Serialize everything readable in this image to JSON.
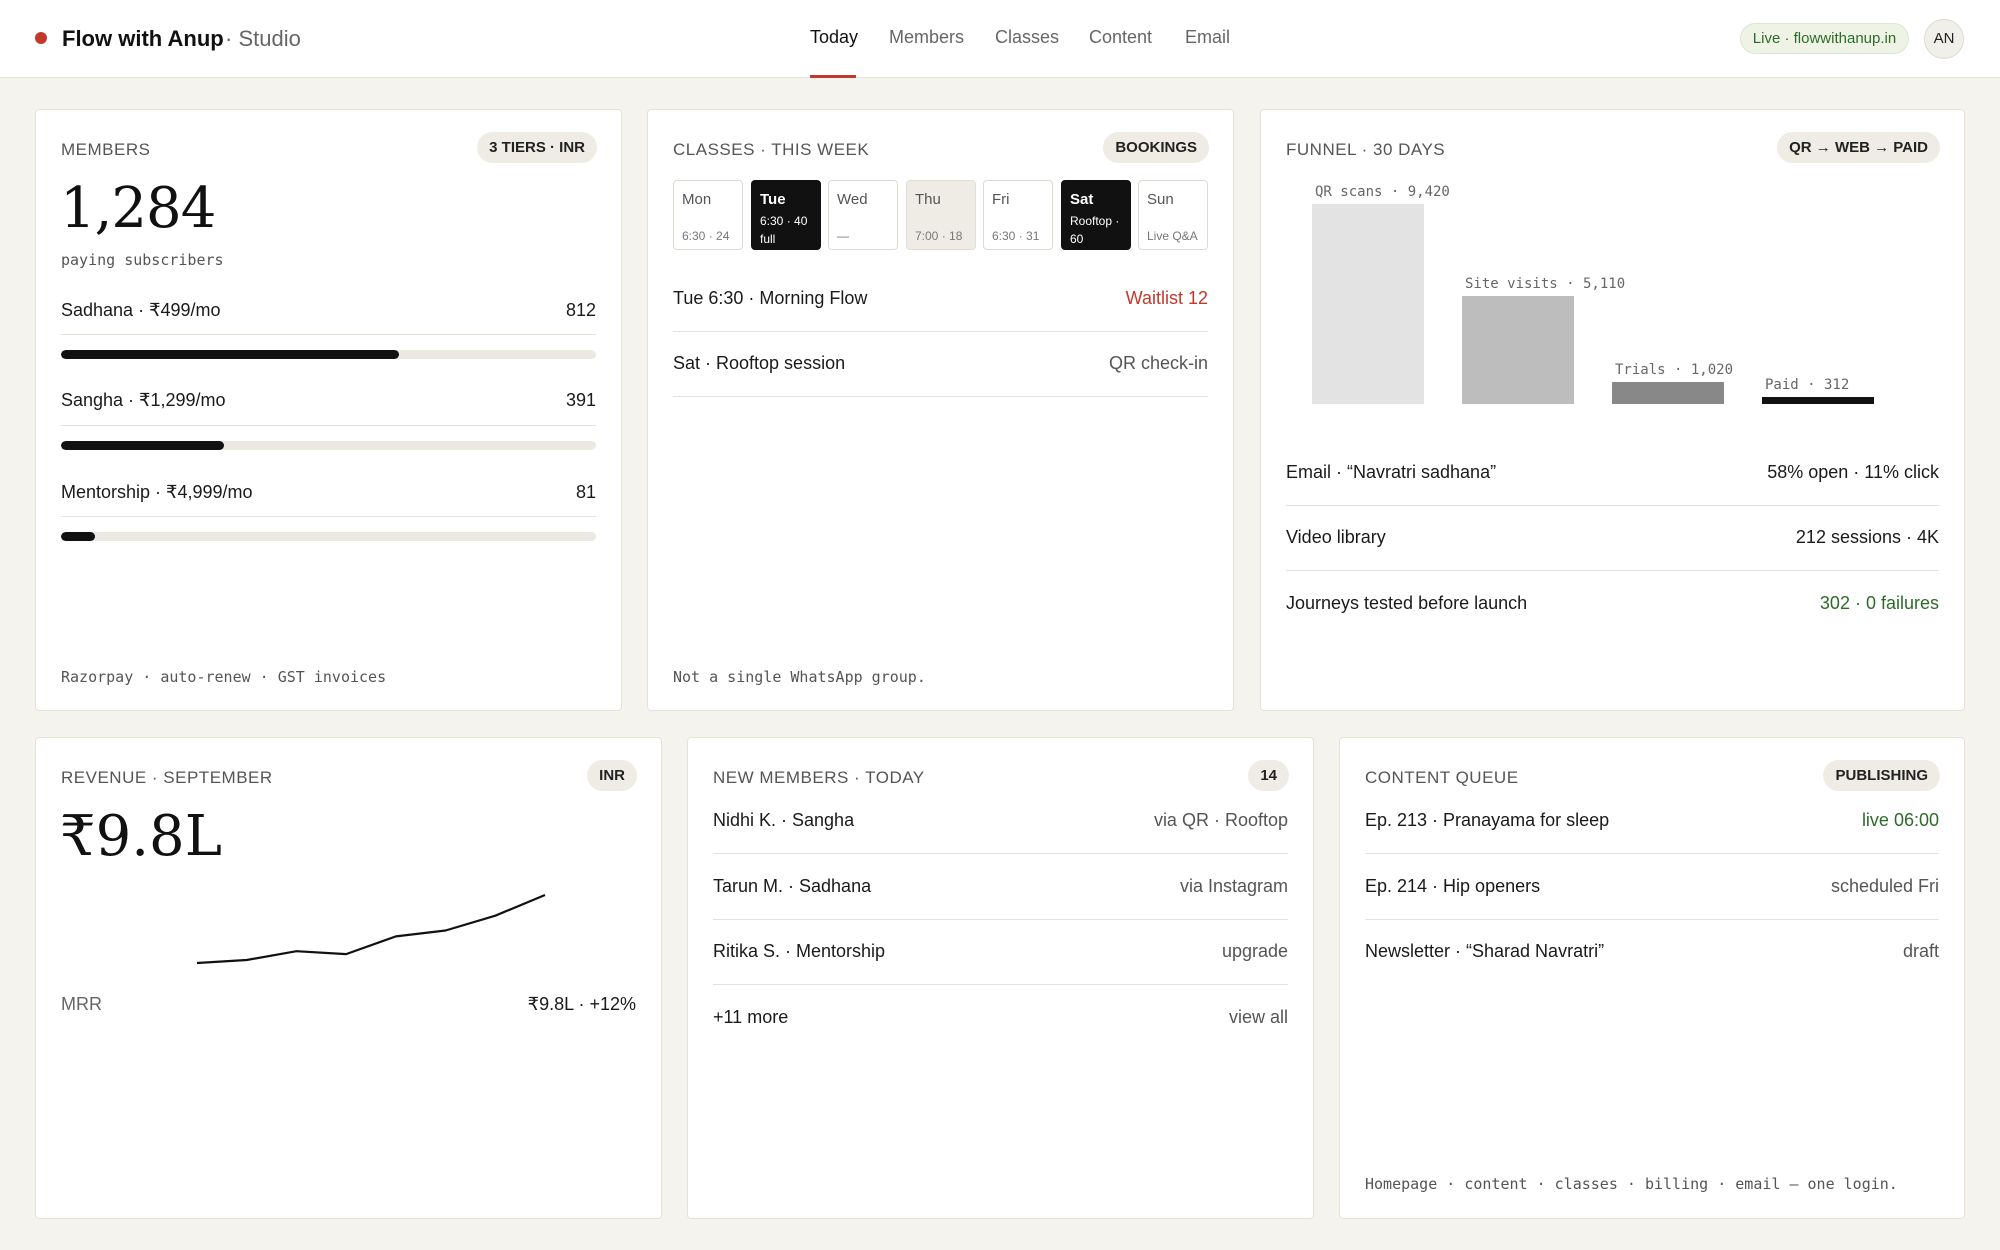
{
  "header": {
    "brand": "Flow with Anup",
    "brand_suffix": "· Studio",
    "tabs": [
      {
        "label": "Today",
        "active": true
      },
      {
        "label": "Members",
        "active": false
      },
      {
        "label": "Classes",
        "active": false
      },
      {
        "label": "Content",
        "active": false
      },
      {
        "label": "Email",
        "active": false
      }
    ],
    "live_status": "Live · flowwithanup.in",
    "avatar_initials": "AN"
  },
  "members": {
    "title": "MEMBERS",
    "badge": "3 TIERS · INR",
    "total": "1,284",
    "total_caption": "paying subscribers",
    "tiers": [
      {
        "label": "Sadhana · ₹499/mo",
        "value": "812",
        "count": 812
      },
      {
        "label": "Sangha · ₹1,299/mo",
        "value": "391",
        "count": 391
      },
      {
        "label": "Mentorship · ₹4,999/mo",
        "value": "81",
        "count": 81
      }
    ],
    "bar_max": 1284,
    "footnote": "Razorpay · auto-renew · GST invoices"
  },
  "classes": {
    "title": "CLASSES · THIS WEEK",
    "badge": "BOOKINGS",
    "days": [
      {
        "day": "Mon",
        "detail": "6:30 · 24",
        "style": "plain"
      },
      {
        "day": "Tue",
        "detail": "6:30 · 40 full",
        "style": "dark"
      },
      {
        "day": "Wed",
        "detail": "—",
        "style": "plain"
      },
      {
        "day": "Thu",
        "detail": "7:00 · 18",
        "style": "tinted"
      },
      {
        "day": "Fri",
        "detail": "6:30 · 31",
        "style": "plain"
      },
      {
        "day": "Sat",
        "detail": "Rooftop · 60",
        "style": "dark"
      },
      {
        "day": "Sun",
        "detail": "Live Q&A",
        "style": "plain"
      }
    ],
    "rows": [
      {
        "left": "Tue 6:30 · Morning Flow",
        "right": "Waitlist 12",
        "tone": "red"
      },
      {
        "left": "Sat · Rooftop session",
        "right": "QR check-in",
        "tone": "muted"
      }
    ],
    "footnote": "Not a single WhatsApp group."
  },
  "funnel": {
    "title": "FUNNEL · 30 DAYS",
    "badge": "QR → WEB → PAID",
    "chart_data": {
      "type": "bar",
      "categories": [
        "QR scans",
        "Site visits",
        "Trials",
        "Paid"
      ],
      "values": [
        9420,
        5110,
        1020,
        312
      ],
      "labels": [
        "QR scans · 9,420",
        "Site visits · 5,110",
        "Trials · 1,020",
        "Paid · 312"
      ],
      "colors": [
        "#e3e3e3",
        "#bdbdbd",
        "#888888",
        "#111111"
      ]
    },
    "rows": [
      {
        "left": "Email · “Navratri sadhana”",
        "right": "58% open · 11% click",
        "tone": "dark"
      },
      {
        "left": "Video library",
        "right": "212 sessions · 4K",
        "tone": "dark"
      },
      {
        "left": "Journeys tested before launch",
        "right": "302 · 0 failures",
        "tone": "green"
      }
    ]
  },
  "revenue": {
    "title": "REVENUE · SEPTEMBER",
    "badge": "INR",
    "amount": "₹9.8L",
    "chart_data": {
      "type": "line",
      "x": [
        1,
        2,
        3,
        4,
        5,
        6,
        7,
        8
      ],
      "values": [
        7.5,
        7.6,
        7.9,
        7.8,
        8.4,
        8.6,
        9.1,
        9.8
      ]
    },
    "metric_label": "MRR",
    "metric_value": "₹9.8L · +12%"
  },
  "new_members": {
    "title": "NEW MEMBERS · TODAY",
    "badge": "14",
    "rows": [
      {
        "left": "Nidhi K. · Sangha",
        "right": "via QR · Rooftop"
      },
      {
        "left": "Tarun M. · Sadhana",
        "right": "via Instagram"
      },
      {
        "left": "Ritika S. · Mentorship",
        "right": "upgrade"
      },
      {
        "left": "+11 more",
        "right": "view all"
      }
    ]
  },
  "content_queue": {
    "title": "CONTENT QUEUE",
    "badge": "PUBLISHING",
    "rows": [
      {
        "left": "Ep. 213 · Pranayama for sleep",
        "right": "live 06:00",
        "tone": "green"
      },
      {
        "left": "Ep. 214 · Hip openers",
        "right": "scheduled Fri",
        "tone": "muted"
      },
      {
        "left": "Newsletter · “Sharad Navratri”",
        "right": "draft",
        "tone": "muted"
      }
    ],
    "footnote": "Homepage · content · classes · billing · email — one login."
  }
}
